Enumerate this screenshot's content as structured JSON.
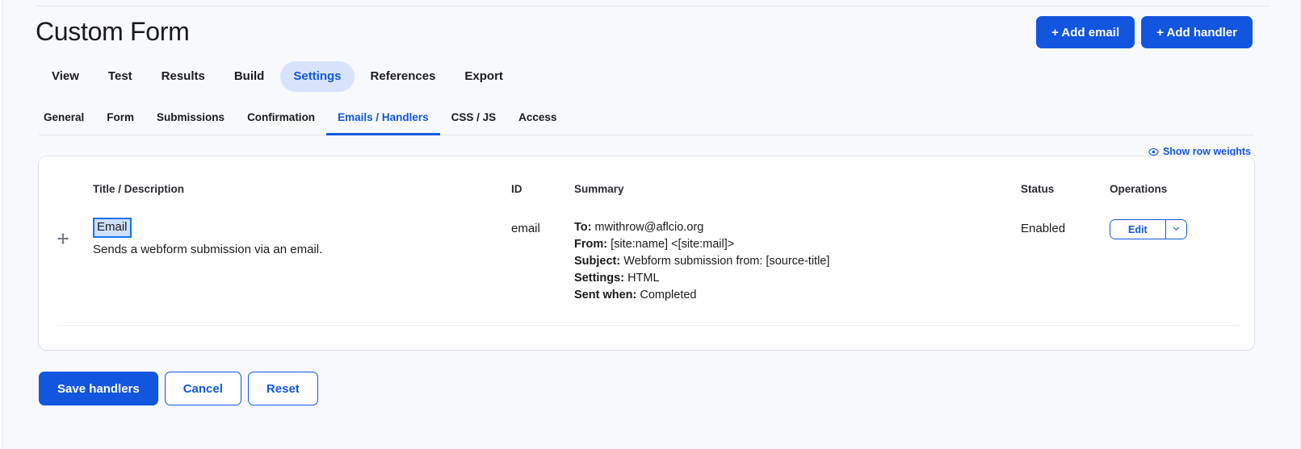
{
  "header": {
    "title": "Custom Form",
    "actions": [
      {
        "label": "+ Add email",
        "name": "add-email-button"
      },
      {
        "label": "+ Add handler",
        "name": "add-handler-button"
      }
    ]
  },
  "primary_tabs": [
    {
      "label": "View",
      "active": false
    },
    {
      "label": "Test",
      "active": false
    },
    {
      "label": "Results",
      "active": false
    },
    {
      "label": "Build",
      "active": false
    },
    {
      "label": "Settings",
      "active": true
    },
    {
      "label": "References",
      "active": false
    },
    {
      "label": "Export",
      "active": false
    }
  ],
  "secondary_tabs": [
    {
      "label": "General",
      "active": false
    },
    {
      "label": "Form",
      "active": false
    },
    {
      "label": "Submissions",
      "active": false
    },
    {
      "label": "Confirmation",
      "active": false
    },
    {
      "label": "Emails / Handlers",
      "active": true
    },
    {
      "label": "CSS / JS",
      "active": false
    },
    {
      "label": "Access",
      "active": false
    }
  ],
  "show_row_weights": {
    "label": "Show row weights",
    "icon": "eye-icon"
  },
  "table": {
    "columns": {
      "title": "Title / Description",
      "id": "ID",
      "summary": "Summary",
      "status": "Status",
      "operations": "Operations"
    },
    "rows": [
      {
        "handle_icon": "move-handle-icon",
        "title": "Email",
        "description": "Sends a webform submission via an email.",
        "id": "email",
        "summary": [
          {
            "label": "To:",
            "value": "mwithrow@aflcio.org"
          },
          {
            "label": "From:",
            "value": "[site:name] <[site:mail]>"
          },
          {
            "label": "Subject:",
            "value": "Webform submission from: [source-title]"
          },
          {
            "label": "Settings:",
            "value": "HTML"
          },
          {
            "label": "Sent when:",
            "value": "Completed"
          }
        ],
        "status": "Enabled",
        "operations": {
          "primary_label": "Edit",
          "toggle_icon": "chevron-down-icon"
        }
      }
    ]
  },
  "footer_actions": [
    {
      "label": "Save handlers",
      "style": "primary",
      "name": "save-handlers-button"
    },
    {
      "label": "Cancel",
      "style": "outline",
      "name": "cancel-button"
    },
    {
      "label": "Reset",
      "style": "outline",
      "name": "reset-button"
    }
  ],
  "colors": {
    "accent": "#1256e0",
    "active_pill_bg": "#d8e3fb",
    "selection_bg": "#cfe0fb",
    "selection_border": "#1a73e8",
    "page_bg": "#f7f9fc",
    "card_bg": "#ffffff",
    "text": "#1b1b1d"
  }
}
